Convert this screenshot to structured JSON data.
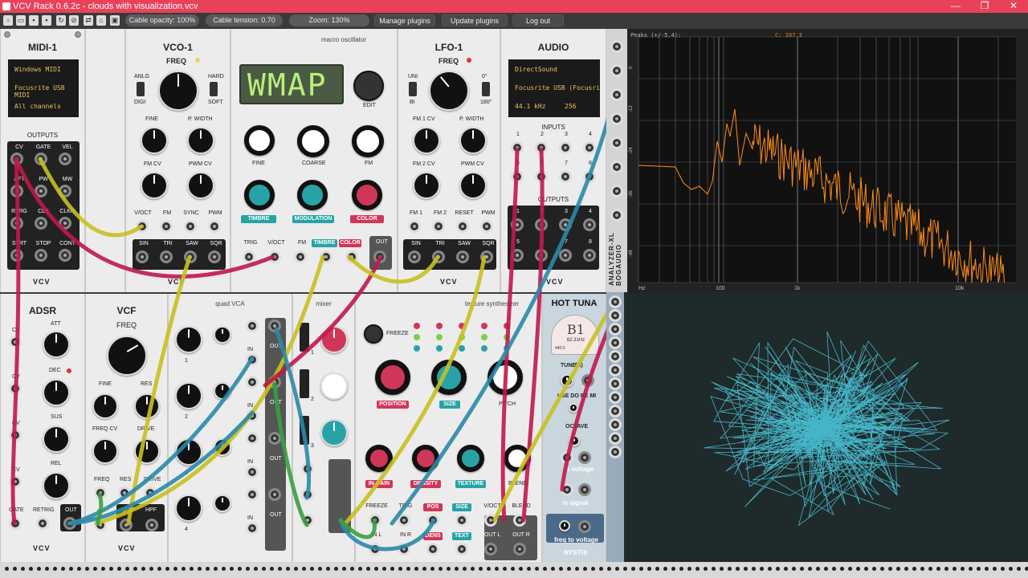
{
  "window": {
    "title": "VCV Rack 0.6.2c - clouds with visualization.vcv",
    "minimize": "—",
    "maximize": "❐",
    "close": "✕"
  },
  "toolbar": {
    "icons": [
      "new-icon",
      "open-icon",
      "save-icon",
      "save-as-icon",
      "revert-icon",
      "disconnect-icon",
      "sample-rate-icon",
      "power-meter-icon",
      "lock-icon"
    ],
    "cable_opacity": "Cable opacity: 100%",
    "cable_tension": "Cable tension: 0.70",
    "zoom": "Zoom: 130%",
    "manage_plugins": "Manage plugins",
    "update_plugins": "Update plugins",
    "log_out": "Log out"
  },
  "midi": {
    "title": "MIDI-1",
    "driver": "Windows MIDI",
    "device": "Focusrite USB MIDI",
    "channel": "All channels",
    "outputs_label": "OUTPUTS",
    "outs": [
      "CV",
      "GATE",
      "VEL",
      "AFT",
      "PW",
      "MW",
      "RTRG",
      "CLK",
      "CLK/2",
      "STRT",
      "STOP",
      "CONT"
    ],
    "brand": "VCV"
  },
  "vco": {
    "title": "VCO-1",
    "freq": "FREQ",
    "anlg": "ANLG",
    "digi": "DIGI",
    "hard": "HARD",
    "soft": "SOFT",
    "fine": "FINE",
    "pwidth": "P. WIDTH",
    "fmcv": "FM CV",
    "pwmcv": "PWM CV",
    "ins": [
      "V/OCT",
      "FM",
      "SYNC",
      "PWM"
    ],
    "outs": [
      "SIN",
      "TRI",
      "SAW",
      "SQR"
    ],
    "brand": "VCV"
  },
  "macro": {
    "title": "macro oscillator",
    "display": "WMAP",
    "edit": "EDIT",
    "fine": "FINE",
    "coarse": "COARSE",
    "fm": "FM",
    "timbre": "TIMBRE",
    "modulation": "MODULATION",
    "color": "COLOR",
    "ins": [
      "TRIG",
      "V/OCT",
      "FM",
      "TIMBRE",
      "COLOR"
    ],
    "out": "OUT",
    "timbre_color": "#27a3a8",
    "color_color": "#d0365a"
  },
  "lfo": {
    "title": "LFO-1",
    "freq": "FREQ",
    "uni": "UNI",
    "bi": "BI",
    "deg0": "0°",
    "deg180": "180°",
    "fm1cv": "FM 1 CV",
    "pwidth": "P. WIDTH",
    "fm2cv": "FM 2 CV",
    "pwmcv": "PWM CV",
    "ins": [
      "FM 1",
      "FM 2",
      "RESET",
      "PWM"
    ],
    "outs": [
      "SIN",
      "TRI",
      "SAW",
      "SQR"
    ],
    "brand": "VCV"
  },
  "audio": {
    "title": "AUDIO",
    "driver": "DirectSound",
    "device": "Focusrite USB (Focusrite USB Audio)",
    "rate": "44.1 kHz",
    "block": "256",
    "inputs_label": "INPUTS",
    "outputs_label": "OUTPUTS",
    "nums": [
      "1",
      "2",
      "3",
      "4",
      "5",
      "6",
      "7",
      "8"
    ],
    "brand": "VCV"
  },
  "adsr": {
    "title": "ADSR",
    "att": "ATT",
    "dec": "DEC",
    "sus": "SUS",
    "rel": "REL",
    "cv": "CV",
    "gate": "GATE",
    "retrig": "RETRIG",
    "out": "OUT",
    "brand": "VCV"
  },
  "vcf": {
    "title": "VCF",
    "freq": "FREQ",
    "fine": "FINE",
    "res": "RES",
    "freqcv": "FREQ CV",
    "drive": "DRIVE",
    "ins": [
      "FREQ",
      "RES",
      "DRIVE"
    ],
    "in": "IN",
    "lpf": "LPF",
    "hpf": "HPF",
    "brand": "VCV"
  },
  "quadvca": {
    "title": "quad VCA",
    "in": "IN",
    "out": "OUT",
    "nums": [
      "1",
      "2",
      "3",
      "4"
    ]
  },
  "mixer": {
    "title": "mixer",
    "nums": [
      "1",
      "2",
      "3"
    ]
  },
  "texture": {
    "title": "texture synthesizer",
    "freeze": "FREEZE",
    "position": "POSITION",
    "size": "SIZE",
    "pitch": "PITCH",
    "in_gain": "IN GAIN",
    "density": "DENSITY",
    "texture": "TEXTURE",
    "blend": "BLEND",
    "ins_top": [
      "FREEZE",
      "TRIG",
      "POS",
      "SIZE",
      "V/OCT",
      "BLEND"
    ],
    "ins_bottom": [
      "IN L",
      "IN R",
      "DENS",
      "TEXT",
      "OUT L",
      "OUT R"
    ]
  },
  "hottuna": {
    "title": "HOT TUNA",
    "note": "B1",
    "freq": "62.31Hz",
    "scale": "440.0",
    "tune": "TUNE",
    "tune_tag": "(A)",
    "use": "USE DO RE MI",
    "octave": "OCTAVE",
    "in_voltage": "in voltage",
    "in_signal": "in signal",
    "freq_to_voltage": "freq to voltage",
    "brand": "NYSTHI"
  },
  "analyzer": {
    "peaks": "Peaks (+/-5.4):",
    "cursor": "C:  207.3",
    "title": "ANALYZER-XL",
    "brand": "BOGAUDIO",
    "xticks": [
      "Hz",
      "100",
      "1k",
      "10k"
    ],
    "yticks": [
      "0",
      "-12",
      "-24",
      "-36",
      "-48"
    ],
    "trace_color": "#ff8c1a"
  },
  "scope": {
    "trace_color": "#4fd8f0"
  }
}
